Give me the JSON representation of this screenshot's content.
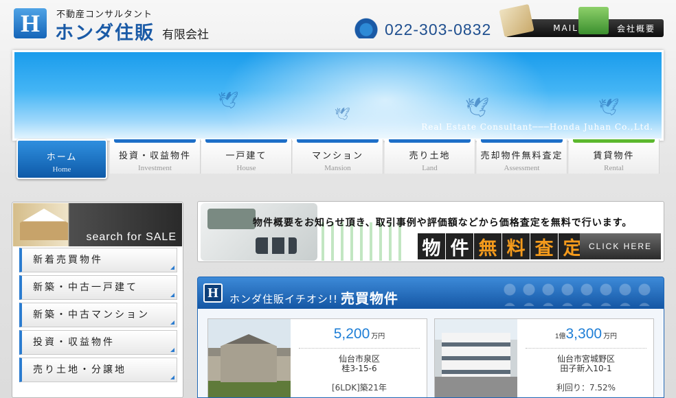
{
  "header": {
    "tagline": "不動産コンサルタント",
    "company_name": "ホンダ住販",
    "company_suffix": "有限会社",
    "phone": "022-303-0832",
    "mail_label": "MAIL",
    "company_info_label": "会社概要"
  },
  "hero": {
    "caption": "Real Estate Consultant───Honda Juhan Co.,Ltd."
  },
  "nav": [
    {
      "jp": "ホーム",
      "en": "Home"
    },
    {
      "jp": "投資・収益物件",
      "en": "Investment"
    },
    {
      "jp": "一戸建て",
      "en": "House"
    },
    {
      "jp": "マンション",
      "en": "Mansion"
    },
    {
      "jp": "売り土地",
      "en": "Land"
    },
    {
      "jp": "売却物件無料査定",
      "en": "Assessment"
    },
    {
      "jp": "賃貸物件",
      "en": "Rental"
    }
  ],
  "nav_colors": [
    "#1e6fc8",
    "#1e6fc8",
    "#1e6fc8",
    "#1e6fc8",
    "#1e6fc8",
    "#1e6fc8",
    "#5cb82e"
  ],
  "sidebar": {
    "heading": "search for SALE",
    "items": [
      "新着売買物件",
      "新築・中古一戸建て",
      "新築・中古マンション",
      "投資・収益物件",
      "売り土地・分譲地"
    ]
  },
  "assessment": {
    "text": "物件概要をお知らせ頂き、取引事例や評価額などから価格査定を無料で行います。",
    "big_chars": [
      "物",
      "件",
      "無",
      "料",
      "査",
      "定"
    ],
    "cta": "CLICK HERE"
  },
  "featured": {
    "logo": "H",
    "title_prefix": "ホンダ住販イチオシ!!",
    "title_main": "売買物件",
    "cards": [
      {
        "price_oku": "",
        "price": "5,200",
        "unit": "万円",
        "addr1": "仙台市泉区",
        "addr2": "桂3-15-6",
        "meta": "[6LDK]築21年"
      },
      {
        "price_oku": "1億",
        "price": "3,300",
        "unit": "万円",
        "addr1": "仙台市宮城野区",
        "addr2": "田子新入10-1",
        "meta": "利回り：7.52%"
      }
    ]
  }
}
